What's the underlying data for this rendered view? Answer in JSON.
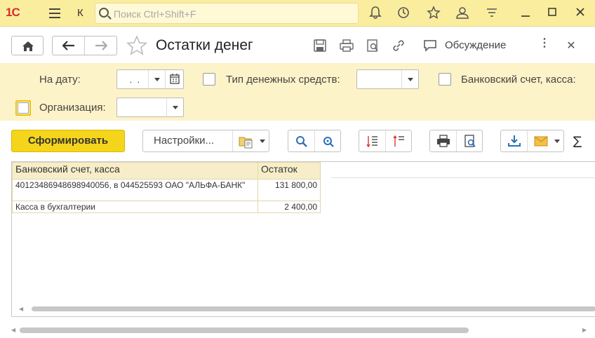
{
  "app": {
    "logo_text": "1С",
    "k_label": "К",
    "search_placeholder": "Поиск Ctrl+Shift+F"
  },
  "header": {
    "title": "Остатки денег",
    "discussion_label": "Обсуждение"
  },
  "filters": {
    "date_label": "На дату:",
    "date_value": " .  . ",
    "cash_type_label": "Тип денежных средств:",
    "cash_type_value": "",
    "bank_account_label": "Банковский счет, касса:",
    "organization_label": "Организация:",
    "organization_value": ""
  },
  "toolbar": {
    "generate_label": "Сформировать",
    "settings_label": "Настройки..."
  },
  "report": {
    "columns": [
      "Банковский счет, касса",
      "Остаток"
    ],
    "rows": [
      {
        "account": "40123486948698940056, в 044525593 ОАО \"АЛЬФА-БАНК\"",
        "balance": "131 800,00"
      },
      {
        "account": "Касса в бухгалтерии",
        "balance": "2 400,00"
      }
    ]
  }
}
